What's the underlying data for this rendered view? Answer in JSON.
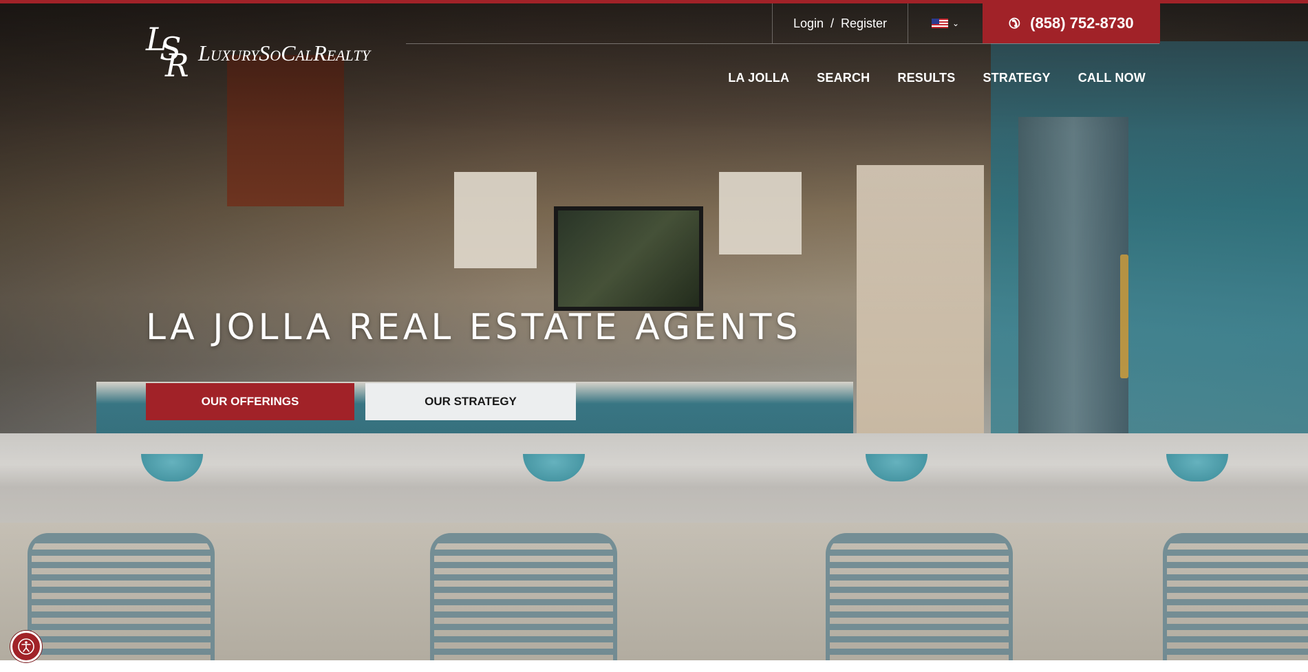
{
  "colors": {
    "accent": "#a12228",
    "secondary_button_bg": "#eceeef",
    "text_light": "#ffffff"
  },
  "logo": {
    "monogram_letters": [
      "L",
      "S",
      "R"
    ],
    "wordmark": "LuxurySoCalRealty"
  },
  "utility_bar": {
    "login_label": "Login",
    "separator": "/",
    "register_label": "Register",
    "language_icon": "us-flag-icon",
    "language_dropdown_icon": "chevron-down-icon",
    "phone_icon": "phone-icon",
    "phone_number": "(858) 752-8730"
  },
  "nav": {
    "items": [
      {
        "label": "LA JOLLA"
      },
      {
        "label": "SEARCH"
      },
      {
        "label": "RESULTS"
      },
      {
        "label": "STRATEGY"
      },
      {
        "label": "CALL NOW"
      }
    ]
  },
  "hero": {
    "title": "LA JOLLA REAL ESTATE AGENTS",
    "primary_cta": "OUR OFFERINGS",
    "secondary_cta": "OUR STRATEGY",
    "background": "kitchen-photo"
  },
  "accessibility": {
    "icon": "accessibility-icon"
  }
}
